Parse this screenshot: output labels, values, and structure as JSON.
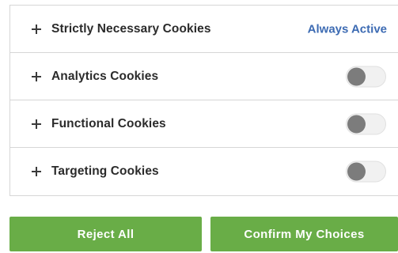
{
  "categories": [
    {
      "label": "Strictly Necessary Cookies",
      "status": "Always Active",
      "enabled": true
    },
    {
      "label": "Analytics Cookies",
      "enabled": false
    },
    {
      "label": "Functional Cookies",
      "enabled": false
    },
    {
      "label": "Targeting Cookies",
      "enabled": false
    }
  ],
  "actions": {
    "reject_label": "Reject All",
    "confirm_label": "Confirm My Choices"
  },
  "colors": {
    "accent_button": "#69ad47",
    "always_active_text": "#3d6bb3",
    "toggle_off_knob": "#7c7c7c"
  },
  "icons": {
    "expand": "plus-icon"
  }
}
